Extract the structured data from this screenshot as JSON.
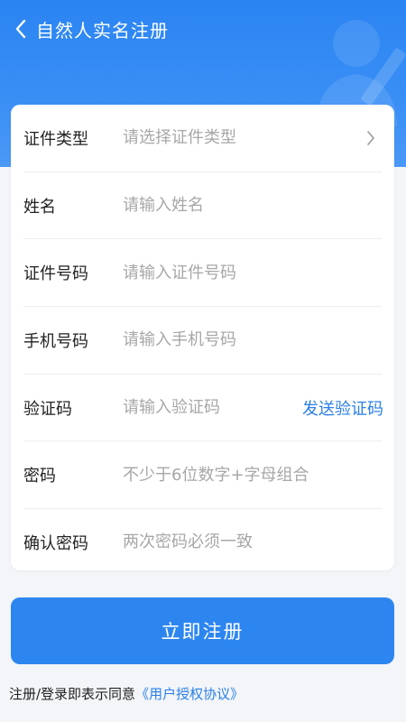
{
  "header": {
    "title": "自然人实名注册",
    "back_icon": "chevron-left-icon"
  },
  "colors": {
    "brand_blue": "#2d86f0",
    "link_blue": "#2a7fe8",
    "background": "#f3f5f9"
  },
  "form": {
    "id_type": {
      "label": "证件类型",
      "placeholder": "请选择证件类型",
      "value": ""
    },
    "name": {
      "label": "姓名",
      "placeholder": "请输入姓名",
      "value": ""
    },
    "id_number": {
      "label": "证件号码",
      "placeholder": "请输入证件号码",
      "value": ""
    },
    "phone": {
      "label": "手机号码",
      "placeholder": "请输入手机号码",
      "value": ""
    },
    "code": {
      "label": "验证码",
      "placeholder": "请输入验证码",
      "value": "",
      "send_label": "发送验证码"
    },
    "password": {
      "label": "密码",
      "placeholder": "不少于6位数字+字母组合",
      "value": ""
    },
    "confirm_password": {
      "label": "确认密码",
      "placeholder": "两次密码必须一致",
      "value": ""
    }
  },
  "submit": {
    "label": "立即注册"
  },
  "agreement": {
    "prefix": "注册/登录即表示同意",
    "link": "《用户授权协议》"
  }
}
